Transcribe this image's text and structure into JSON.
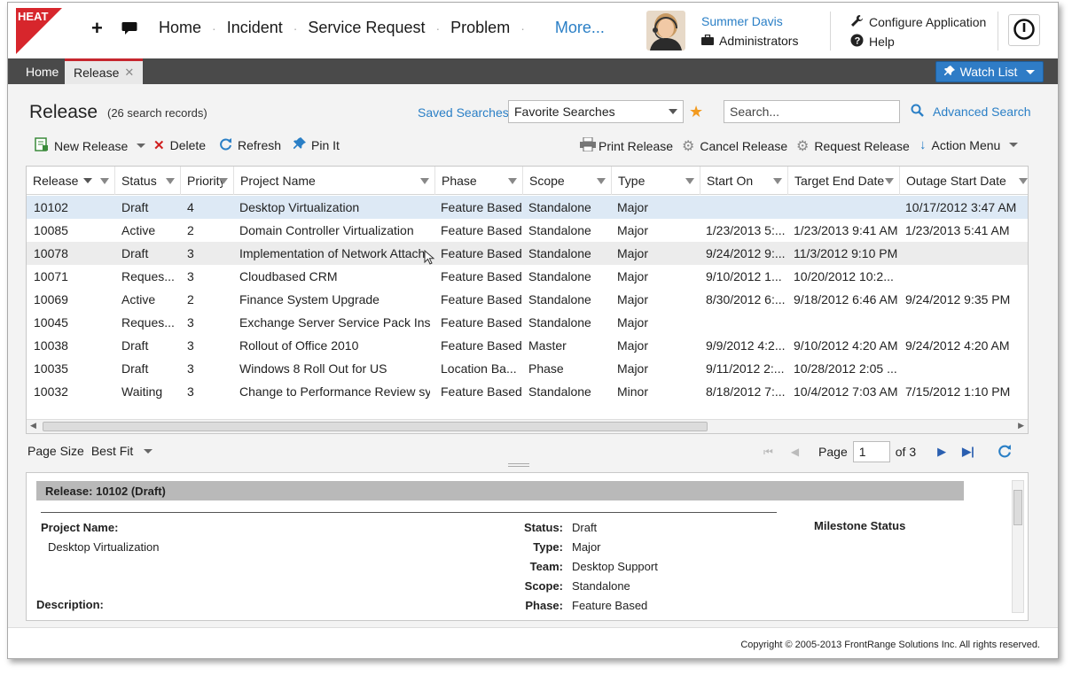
{
  "app": {
    "logo_text": "HEAT"
  },
  "nav": {
    "home": "Home",
    "incident": "Incident",
    "service_request": "Service Request",
    "problem": "Problem",
    "more": "More..."
  },
  "user": {
    "name": "Summer Davis",
    "role": "Administrators"
  },
  "header_links": {
    "configure": "Configure Application",
    "help": "Help"
  },
  "tabs": [
    {
      "label": "Home"
    },
    {
      "label": "Release"
    }
  ],
  "watch_list": "Watch List",
  "page": {
    "title": "Release",
    "count": "(26 search records)",
    "saved_searches": "Saved Searches",
    "favorite_searches": "Favorite Searches",
    "search_placeholder": "Search...",
    "advanced_search": "Advanced Search"
  },
  "toolbar": {
    "new_release": "New Release",
    "delete": "Delete",
    "refresh": "Refresh",
    "pin_it": "Pin It",
    "print_release": "Print Release",
    "cancel_release": "Cancel Release",
    "request_release": "Request Release",
    "action_menu": "Action Menu"
  },
  "grid": {
    "columns": [
      "Release",
      "Status",
      "Priority",
      "Project Name",
      "Phase",
      "Scope",
      "Type",
      "Start On",
      "Target End Date",
      "Outage Start Date"
    ],
    "rows": [
      [
        "10102",
        "Draft",
        "4",
        "Desktop Virtualization",
        "Feature Based",
        "Standalone",
        "Major",
        "",
        "",
        "10/17/2012 3:47 AM"
      ],
      [
        "10085",
        "Active",
        "2",
        "Domain Controller Virtualization",
        "Feature Based",
        "Standalone",
        "Major",
        "1/23/2013 5:...",
        "1/23/2013 9:41 AM",
        "1/23/2013 5:41 AM"
      ],
      [
        "10078",
        "Draft",
        "3",
        "Implementation of Network Attach...",
        "Feature Based",
        "Standalone",
        "Major",
        "9/24/2012 9:...",
        "11/3/2012 9:10 PM",
        ""
      ],
      [
        "10071",
        "Reques...",
        "3",
        "Cloudbased CRM",
        "Feature Based",
        "Standalone",
        "Major",
        "9/10/2012 1...",
        "10/20/2012 10:2...",
        ""
      ],
      [
        "10069",
        "Active",
        "2",
        "Finance System Upgrade",
        "Feature Based",
        "Standalone",
        "Major",
        "8/30/2012 6:...",
        "9/18/2012 6:46 AM",
        "9/24/2012 9:35 PM"
      ],
      [
        "10045",
        "Reques...",
        "3",
        "Exchange Server Service Pack Ins...",
        "Feature Based",
        "Standalone",
        "Major",
        "",
        "",
        ""
      ],
      [
        "10038",
        "Draft",
        "3",
        "Rollout of Office 2010",
        "Feature Based",
        "Master",
        "Major",
        "9/9/2012 4:2...",
        "9/10/2012 4:20 AM",
        "9/24/2012 4:20 AM"
      ],
      [
        "10035",
        "Draft",
        "3",
        "Windows 8 Roll Out for US",
        "Location Ba...",
        "Phase",
        "Major",
        "9/11/2012 2:...",
        "10/28/2012 2:05 ...",
        ""
      ],
      [
        "10032",
        "Waiting",
        "3",
        "Change to Performance Review sy...",
        "Feature Based",
        "Standalone",
        "Minor",
        "8/18/2012 7:...",
        "10/4/2012 7:03 AM",
        "7/15/2012 1:10 PM"
      ]
    ]
  },
  "pager": {
    "page_size_label": "Page Size",
    "page_size_value": "Best Fit",
    "page_label": "Page",
    "page_value": "1",
    "of_label": "of 3"
  },
  "details": {
    "header": "Release: 10102 (Draft)",
    "project_name_label": "Project Name:",
    "project_name_value": "Desktop Virtualization",
    "description_label": "Description:",
    "status_label": "Status:",
    "status_value": "Draft",
    "type_label": "Type:",
    "type_value": "Major",
    "team_label": "Team:",
    "team_value": "Desktop Support",
    "scope_label": "Scope:",
    "scope_value": "Standalone",
    "phase_label": "Phase:",
    "phase_value": "Feature Based",
    "milestone_label": "Milestone Status"
  },
  "footer": {
    "copyright": "Copyright © 2005-2013 FrontRange Solutions Inc. All rights reserved."
  },
  "colors": {
    "accent_blue": "#2a7fc6",
    "brand_red": "#d7262c",
    "tabbar": "#4a4a4a",
    "watch_button": "#2f7cc6"
  }
}
